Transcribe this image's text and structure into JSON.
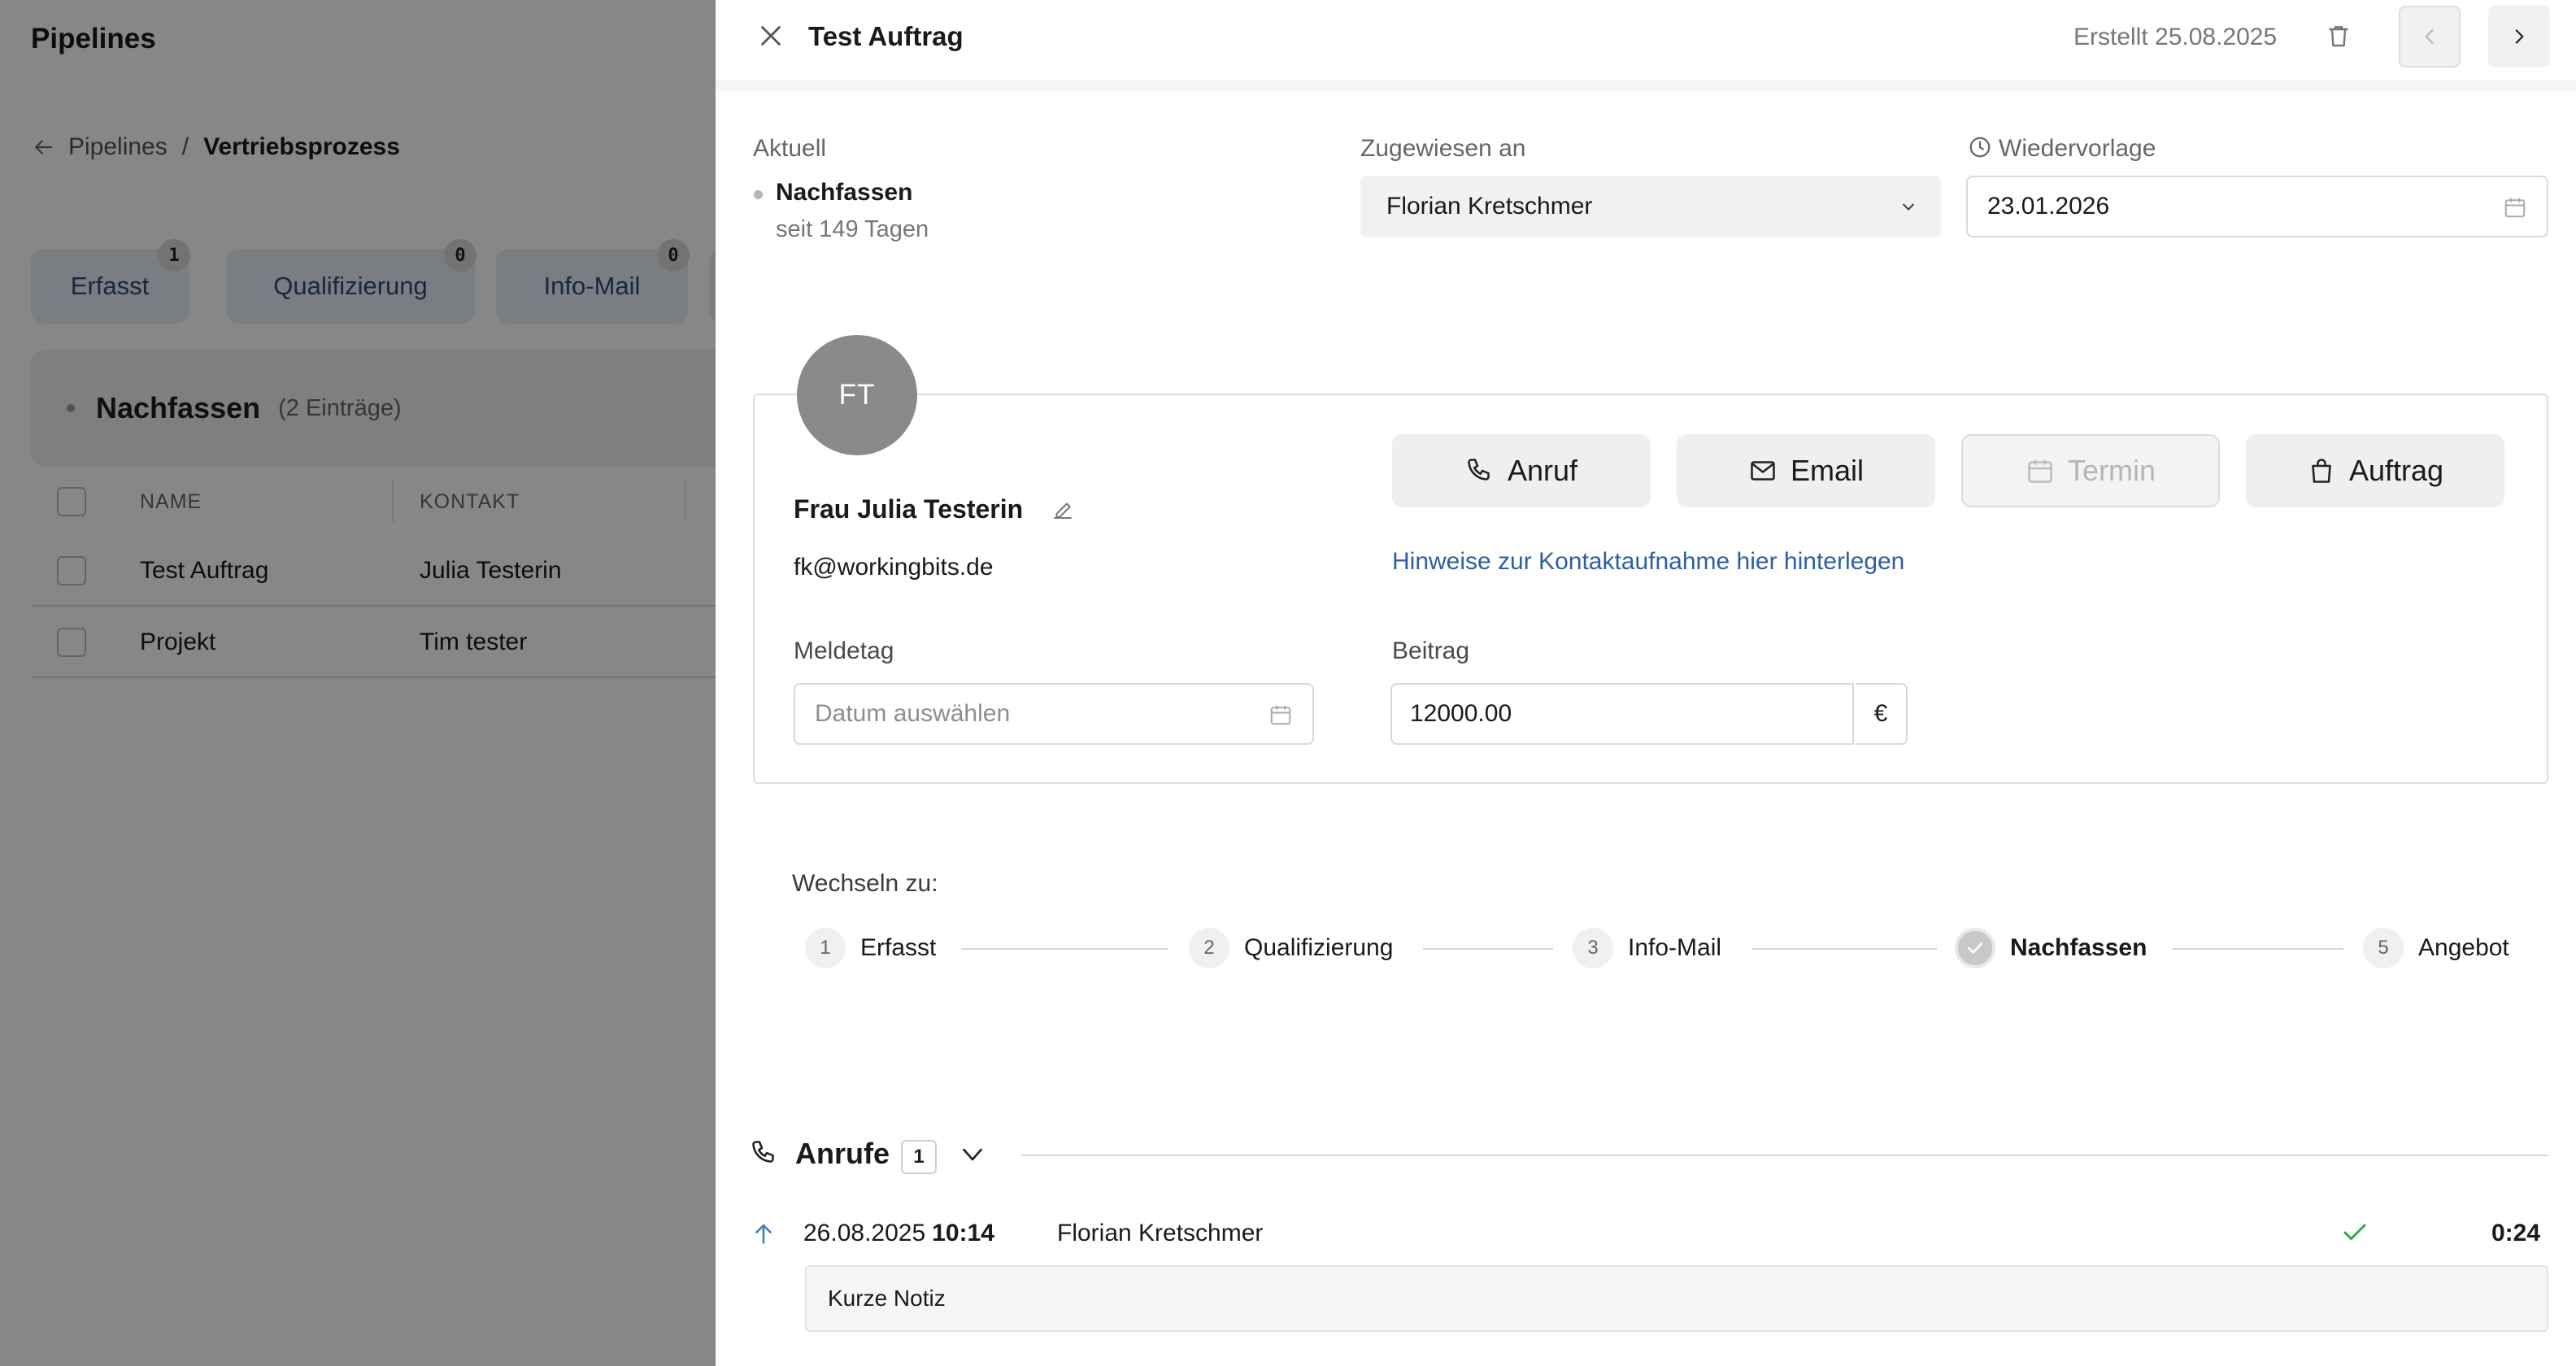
{
  "background": {
    "page_title": "Pipelines",
    "breadcrumb": {
      "parent": "Pipelines",
      "separator": "/",
      "current": "Vertriebsprozess"
    },
    "stage_tabs": [
      {
        "label": "Erfasst",
        "count": "1"
      },
      {
        "label": "Qualifizierung",
        "count": "0"
      },
      {
        "label": "Info-Mail",
        "count": "0"
      }
    ],
    "group": {
      "title": "Nachfassen",
      "count_text": "(2 Einträge)"
    },
    "table": {
      "columns": [
        "NAME",
        "KONTAKT"
      ],
      "rows": [
        {
          "name": "Test Auftrag",
          "contact": "Julia Testerin"
        },
        {
          "name": "Projekt",
          "contact": "Tim tester"
        }
      ]
    }
  },
  "drawer": {
    "title": "Test Auftrag",
    "created": "Erstellt 25.08.2025",
    "current": {
      "label": "Aktuell",
      "stage": "Nachfassen",
      "since": "seit 149 Tagen"
    },
    "assigned": {
      "label": "Zugewiesen an",
      "value": "Florian Kretschmer"
    },
    "followup": {
      "label": "Wiedervorlage",
      "value": "23.01.2026"
    },
    "contact": {
      "initials": "FT",
      "name": "Frau Julia Testerin",
      "email": "fk@workingbits.de",
      "hint_link": "Hinweise zur Kontaktaufnahme hier hinterlegen"
    },
    "actions": [
      {
        "label": "Anruf",
        "icon": "phone-icon",
        "enabled": true
      },
      {
        "label": "Email",
        "icon": "mail-icon",
        "enabled": true
      },
      {
        "label": "Termin",
        "icon": "calendar-icon",
        "enabled": false
      },
      {
        "label": "Auftrag",
        "icon": "bag-icon",
        "enabled": true
      }
    ],
    "report_day": {
      "label": "Meldetag",
      "placeholder": "Datum auswählen"
    },
    "amount": {
      "label": "Beitrag",
      "value": "12000.00",
      "currency": "€"
    },
    "switch_to": {
      "label": "Wechseln zu:",
      "steps": [
        {
          "number": "1",
          "label": "Erfasst"
        },
        {
          "number": "2",
          "label": "Qualifizierung"
        },
        {
          "number": "3",
          "label": "Info-Mail"
        },
        {
          "number": "",
          "label": "Nachfassen",
          "active": true
        },
        {
          "number": "5",
          "label": "Angebot"
        }
      ]
    },
    "calls": {
      "title": "Anrufe",
      "count": "1",
      "items": [
        {
          "date": "26.08.2025",
          "time": "10:14",
          "user": "Florian Kretschmer",
          "duration": "0:24",
          "note": "Kurze Notiz"
        }
      ]
    },
    "colors": {
      "link": "#2e5fa6",
      "success": "#2ea44f",
      "call_direction": "#3b82c4"
    }
  }
}
